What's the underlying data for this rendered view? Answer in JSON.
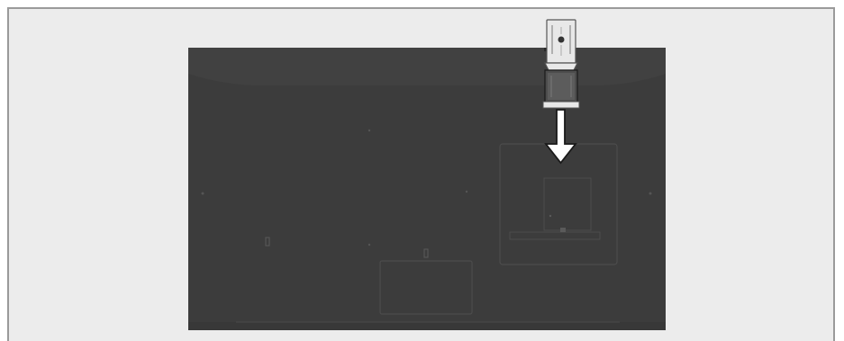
{
  "diagram": {
    "colors": {
      "panel_background": "#ececec",
      "frame_border": "#9a9a9a",
      "tv_back": "#3c3c3c",
      "tv_back_details": "#4a4a4a",
      "module": "#e8e8e8",
      "module_dark": "#4d4d4d",
      "arrow_fill": "#ffffff",
      "arrow_stroke": "#1a1a1a"
    },
    "elements": {
      "tv": "tv-back-panel",
      "module": "ci-module",
      "arrow": "insert-arrow",
      "slot": "ci-slot"
    }
  }
}
